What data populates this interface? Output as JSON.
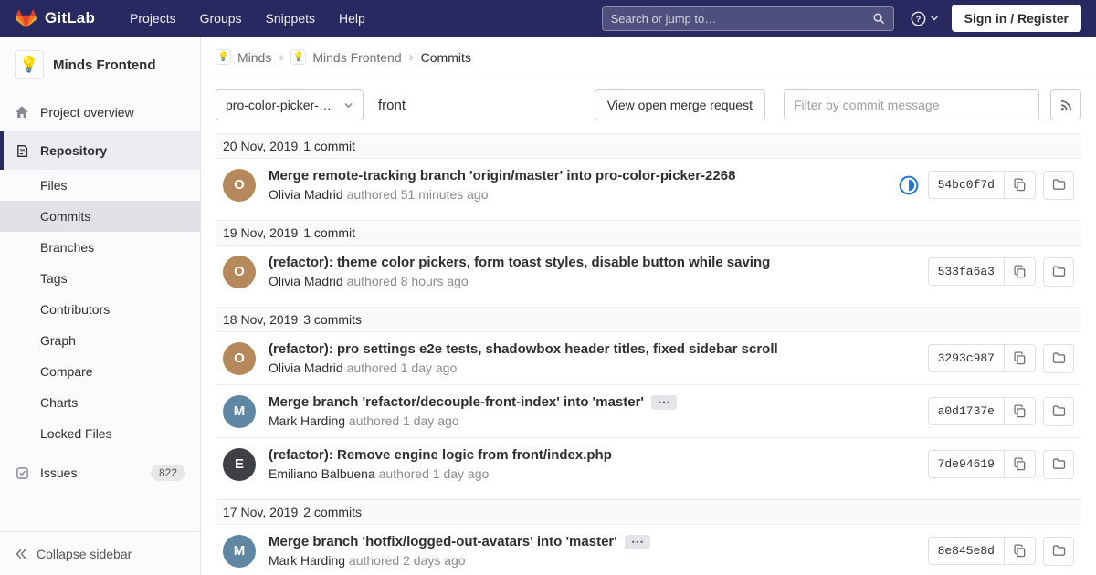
{
  "navbar": {
    "logo_text": "GitLab",
    "menu": [
      "Projects",
      "Groups",
      "Snippets",
      "Help"
    ],
    "search_placeholder": "Search or jump to…",
    "sign_in_label": "Sign in / Register"
  },
  "sidebar": {
    "project_avatar": "💡",
    "project_name": "Minds Frontend",
    "overview_label": "Project overview",
    "repository_label": "Repository",
    "repo_items": [
      "Files",
      "Commits",
      "Branches",
      "Tags",
      "Contributors",
      "Graph",
      "Compare",
      "Charts",
      "Locked Files"
    ],
    "active_repo_item": "Commits",
    "issues_label": "Issues",
    "issues_count": "822",
    "collapse_label": "Collapse sidebar"
  },
  "breadcrumb": {
    "group": "Minds",
    "group_avatar": "💡",
    "project": "Minds Frontend",
    "project_avatar": "💡",
    "page": "Commits",
    "separator": "›"
  },
  "controls": {
    "ref_selector": "pro-color-picker-…",
    "path": "front",
    "mr_button_label": "View open merge request",
    "filter_placeholder": "Filter by commit message"
  },
  "icons": {
    "ellipsis": "⋯"
  },
  "colors": {
    "navbar_bg": "#292961",
    "tanuki_orange": "#fc6d26",
    "tanuki_red": "#e24329",
    "tanuki_yellow": "#fca326",
    "ci_running_blue": "#1f78d1",
    "active_indicator": "#292961"
  },
  "groups": [
    {
      "date": "20 Nov, 2019",
      "count": "1 commit",
      "commits": [
        {
          "title": "Merge remote-tracking branch 'origin/master' into pro-color-picker-2268",
          "author": "Olivia Madrid",
          "meta": "authored 51 minutes ago",
          "sha": "54bc0f7d",
          "initial": "O",
          "ci_status": "running"
        }
      ]
    },
    {
      "date": "19 Nov, 2019",
      "count": "1 commit",
      "commits": [
        {
          "title": "(refactor): theme color pickers, form toast styles, disable button while saving",
          "author": "Olivia Madrid",
          "meta": "authored 8 hours ago",
          "sha": "533fa6a3",
          "initial": "O"
        }
      ]
    },
    {
      "date": "18 Nov, 2019",
      "count": "3 commits",
      "commits": [
        {
          "title": "(refactor): pro settings e2e tests, shadowbox header titles, fixed sidebar scroll",
          "author": "Olivia Madrid",
          "meta": "authored 1 day ago",
          "sha": "3293c987",
          "initial": "O"
        },
        {
          "title": "Merge branch 'refactor/decouple-front-index' into 'master'",
          "author": "Mark Harding",
          "meta": "authored 1 day ago",
          "sha": "a0d1737e",
          "initial": "M",
          "expandable": true
        },
        {
          "title": "(refactor): Remove engine logic from front/index.php",
          "author": "Emiliano Balbuena",
          "meta": "authored 1 day ago",
          "sha": "7de94619",
          "initial": "E"
        }
      ]
    },
    {
      "date": "17 Nov, 2019",
      "count": "2 commits",
      "commits": [
        {
          "title": "Merge branch 'hotfix/logged-out-avatars' into 'master'",
          "author": "Mark Harding",
          "meta": "authored 2 days ago",
          "sha": "8e845e8d",
          "initial": "M",
          "expandable": true
        }
      ]
    }
  ]
}
